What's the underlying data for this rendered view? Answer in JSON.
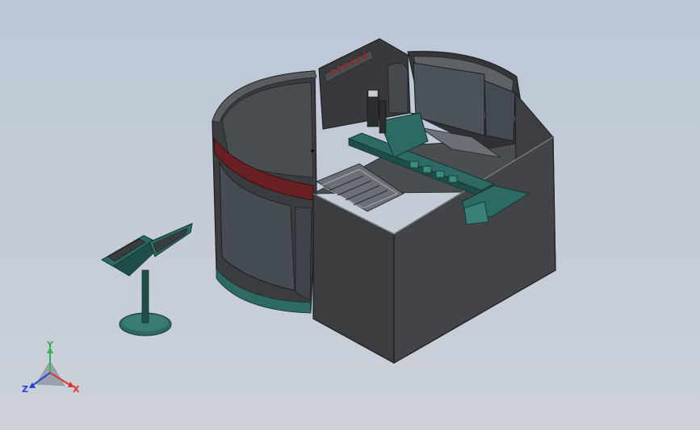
{
  "viewport": {
    "background_top": "#bcc7d6",
    "background_bottom": "#ccd1d9"
  },
  "triad": {
    "x_label": "X",
    "y_label": "Y",
    "z_label": "Z",
    "x_color": "#e0342c",
    "y_color": "#33b34a",
    "z_color": "#2a3fd6"
  },
  "model": {
    "body_color": "#3b3d3f",
    "frame_color": "#2d6a63",
    "stripe_color": "#6a1f22",
    "window_color": "#424a52"
  }
}
